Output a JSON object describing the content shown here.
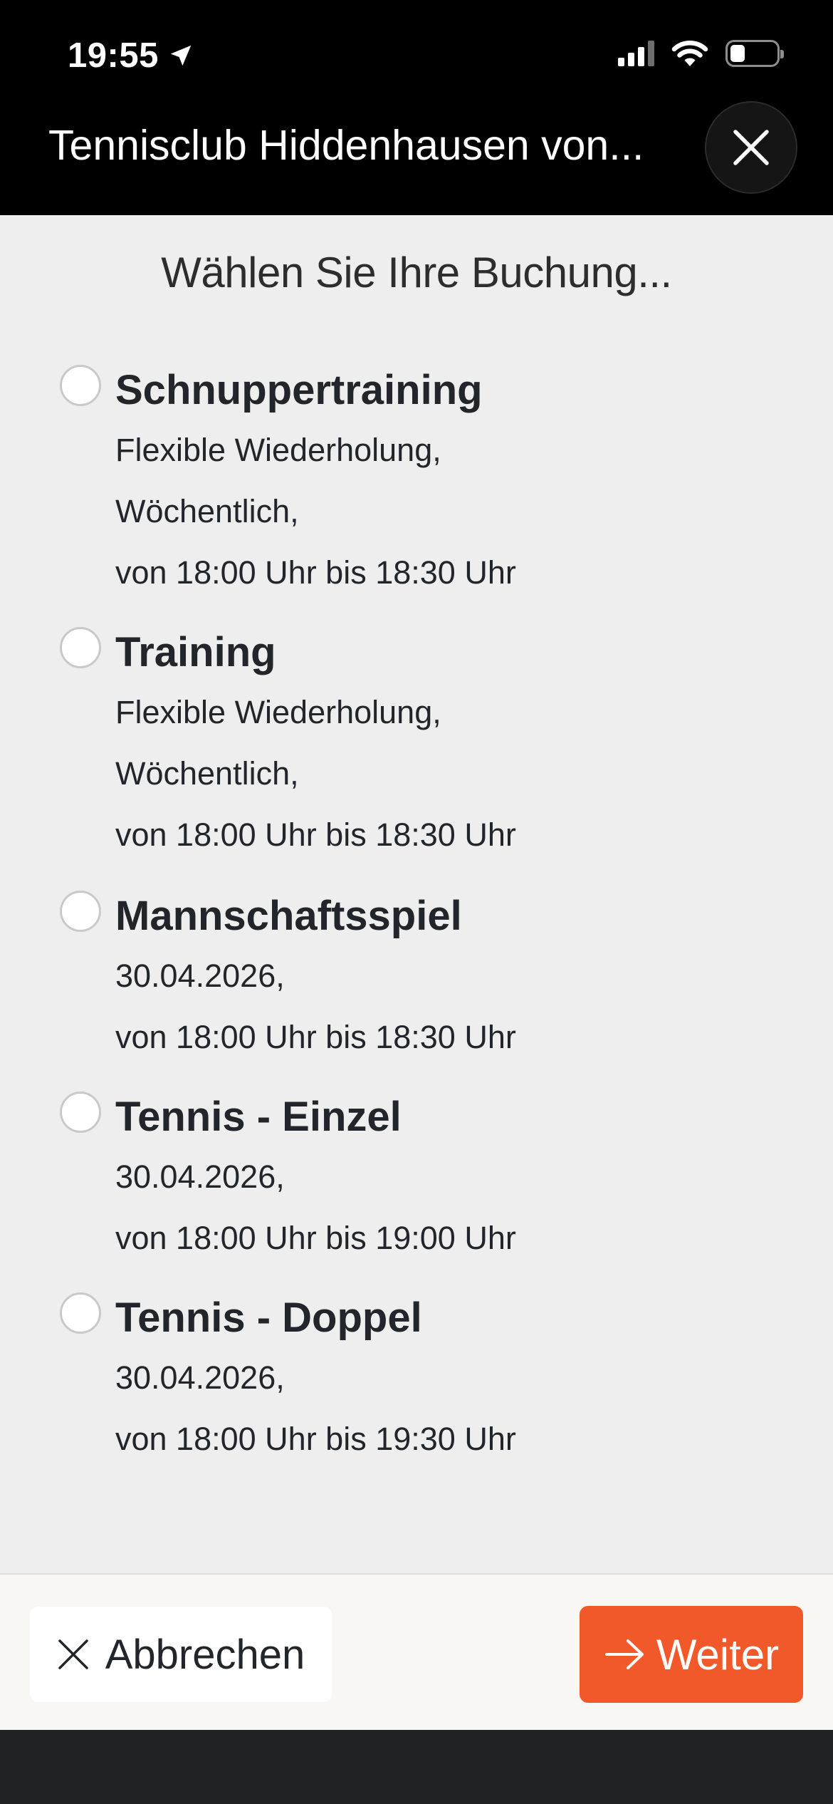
{
  "status_bar": {
    "time": "19:55"
  },
  "header": {
    "title": "Tennisclub Hiddenhausen von...",
    "close_icon": "close-icon"
  },
  "subtitle": "Wählen Sie Ihre Buchung...",
  "options": [
    {
      "title": "Schnuppertraining",
      "lines": [
        "Flexible Wiederholung,",
        "Wöchentlich,",
        "von 18:00 Uhr bis 18:30 Uhr"
      ],
      "selected": false
    },
    {
      "title": "Training",
      "lines": [
        "Flexible Wiederholung,",
        "Wöchentlich,",
        "von 18:00 Uhr bis 18:30 Uhr"
      ],
      "selected": false
    },
    {
      "title": "Mannschaftsspiel",
      "lines": [
        "30.04.2026,",
        "von 18:00 Uhr bis 18:30 Uhr"
      ],
      "selected": false
    },
    {
      "title": "Tennis - Einzel",
      "lines": [
        "30.04.2026,",
        "von 18:00 Uhr bis 19:00 Uhr"
      ],
      "selected": false
    },
    {
      "title": "Tennis - Doppel",
      "lines": [
        "30.04.2026,",
        "von 18:00 Uhr bis 19:30 Uhr"
      ],
      "selected": false
    }
  ],
  "footer": {
    "cancel_label": "Abbrechen",
    "next_label": "Weiter"
  },
  "colors": {
    "accent": "#f1592a",
    "header_bg": "#000000",
    "content_bg": "#eeeeee"
  }
}
